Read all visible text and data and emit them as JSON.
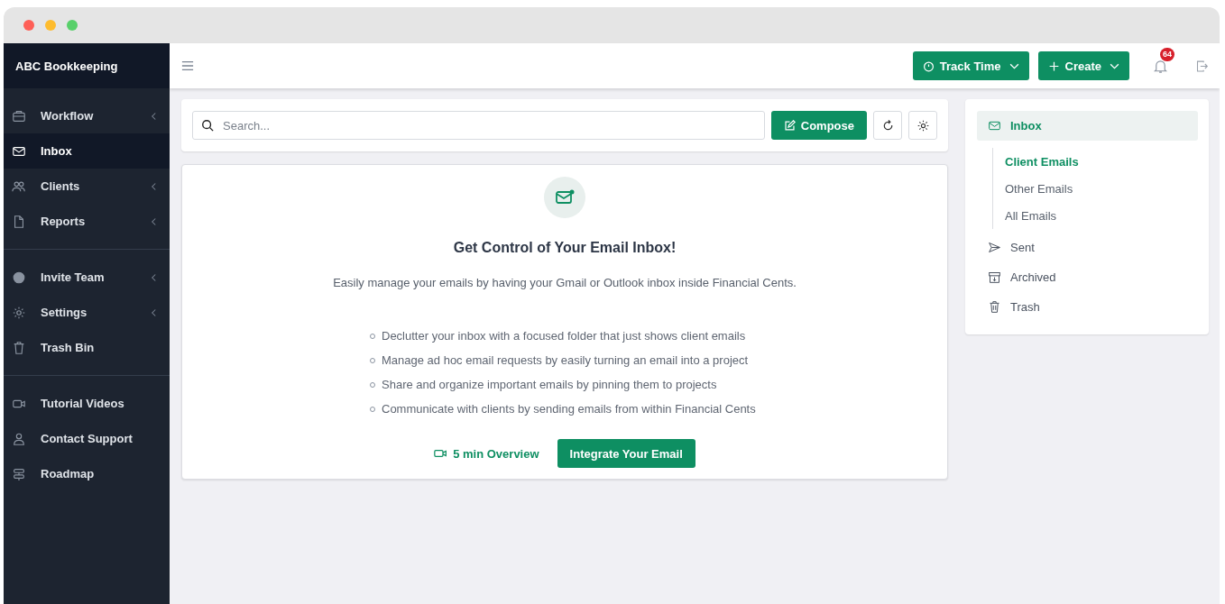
{
  "brand": "ABC Bookkeeping",
  "sidebar": {
    "groups": [
      [
        {
          "label": "Workflow",
          "selected": false,
          "has_submenu": true
        },
        {
          "label": "Inbox",
          "selected": true,
          "has_submenu": false
        },
        {
          "label": "Clients",
          "selected": false,
          "has_submenu": true
        },
        {
          "label": "Reports",
          "selected": false,
          "has_submenu": true
        }
      ],
      [
        {
          "label": "Invite Team",
          "selected": false,
          "has_submenu": true
        },
        {
          "label": "Settings",
          "selected": false,
          "has_submenu": true
        },
        {
          "label": "Trash Bin",
          "selected": false,
          "has_submenu": false
        }
      ],
      [
        {
          "label": "Tutorial Videos",
          "selected": false,
          "has_submenu": false
        },
        {
          "label": "Contact Support",
          "selected": false,
          "has_submenu": false
        },
        {
          "label": "Roadmap",
          "selected": false,
          "has_submenu": false
        }
      ]
    ]
  },
  "header": {
    "track_time": "Track Time",
    "create": "Create",
    "notification_count": "64"
  },
  "search": {
    "placeholder": "Search..."
  },
  "compose": "Compose",
  "empty_state": {
    "title": "Get Control of Your Email Inbox!",
    "subtitle": "Easily manage your emails by having your Gmail or Outlook inbox inside Financial Cents.",
    "bullets": [
      "Declutter your inbox with a focused folder that just shows client emails",
      "Manage ad hoc email requests by easily turning an email into a project",
      "Share and organize important emails by pinning them to projects",
      "Communicate with clients by sending emails from within Financial Cents"
    ],
    "overview_link": "5 min Overview",
    "integrate_button": "Integrate Your Email"
  },
  "folders": [
    {
      "label": "Inbox",
      "selected": true,
      "children": [
        {
          "label": "Client Emails",
          "selected": true
        },
        {
          "label": "Other Emails",
          "selected": false
        },
        {
          "label": "All Emails",
          "selected": false
        }
      ]
    },
    {
      "label": "Sent",
      "selected": false
    },
    {
      "label": "Archived",
      "selected": false
    },
    {
      "label": "Trash",
      "selected": false
    }
  ]
}
